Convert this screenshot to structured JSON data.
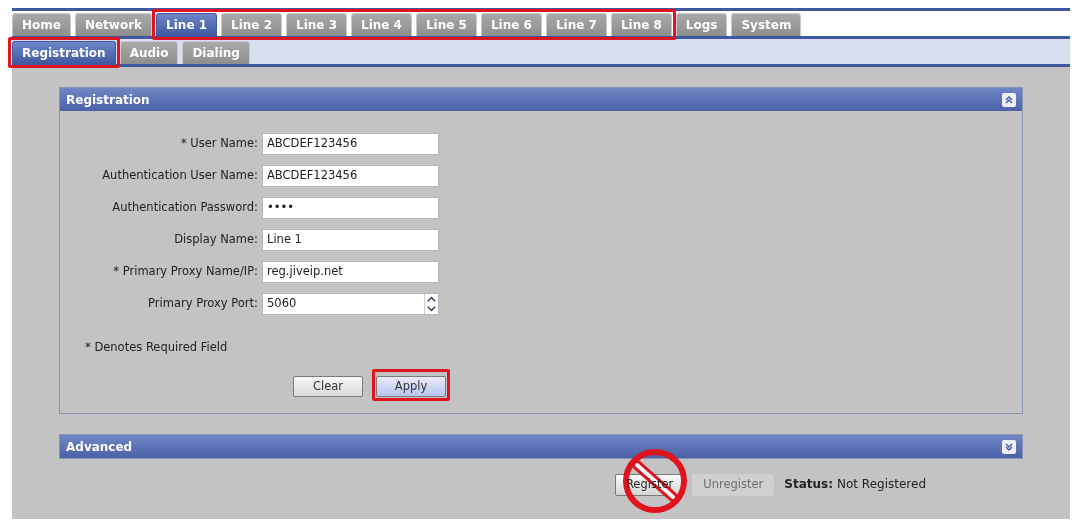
{
  "tab_groups": [
    {
      "highlighted": false,
      "tabs": [
        {
          "label": "Home",
          "selected": false
        },
        {
          "label": "Network",
          "selected": false
        }
      ]
    },
    {
      "highlighted": true,
      "tabs": [
        {
          "label": "Line 1",
          "selected": true
        },
        {
          "label": "Line 2",
          "selected": false
        },
        {
          "label": "Line 3",
          "selected": false
        },
        {
          "label": "Line 4",
          "selected": false
        },
        {
          "label": "Line 5",
          "selected": false
        },
        {
          "label": "Line 6",
          "selected": false
        },
        {
          "label": "Line 7",
          "selected": false
        },
        {
          "label": "Line 8",
          "selected": false
        }
      ]
    },
    {
      "highlighted": false,
      "tabs": [
        {
          "label": "Logs",
          "selected": false
        },
        {
          "label": "System",
          "selected": false
        }
      ]
    }
  ],
  "subtab_groups": [
    {
      "highlighted": true,
      "tabs": [
        {
          "label": "Registration",
          "selected": true
        }
      ]
    },
    {
      "highlighted": false,
      "tabs": [
        {
          "label": "Audio",
          "selected": false
        },
        {
          "label": "Dialing",
          "selected": false
        }
      ]
    }
  ],
  "registration_panel": {
    "title": "Registration",
    "expanded": true,
    "fields": [
      {
        "label": "* User Name:",
        "value": "ABCDEF123456",
        "kind": "text"
      },
      {
        "label": "Authentication User Name:",
        "value": "ABCDEF123456",
        "kind": "text"
      },
      {
        "label": "Authentication Password:",
        "value": "••••",
        "kind": "text"
      },
      {
        "label": "Display Name:",
        "value": "Line 1",
        "kind": "text"
      },
      {
        "label": "* Primary Proxy Name/IP:",
        "value": "reg.jiveip.net",
        "kind": "text"
      },
      {
        "label": "Primary Proxy Port:",
        "value": "5060",
        "kind": "spinner"
      }
    ],
    "note": "* Denotes Required Field",
    "buttons": [
      {
        "label": "Clear",
        "highlighted": false
      },
      {
        "label": "Apply",
        "highlighted": true
      }
    ]
  },
  "advanced_panel": {
    "title": "Advanced",
    "expanded": false
  },
  "actions": [
    {
      "label": "Register",
      "disabled": false,
      "crossed_out": true
    },
    {
      "label": "Unregister",
      "disabled": true,
      "crossed_out": false
    }
  ],
  "status": {
    "label": "Status:",
    "value": "Not Registered"
  }
}
